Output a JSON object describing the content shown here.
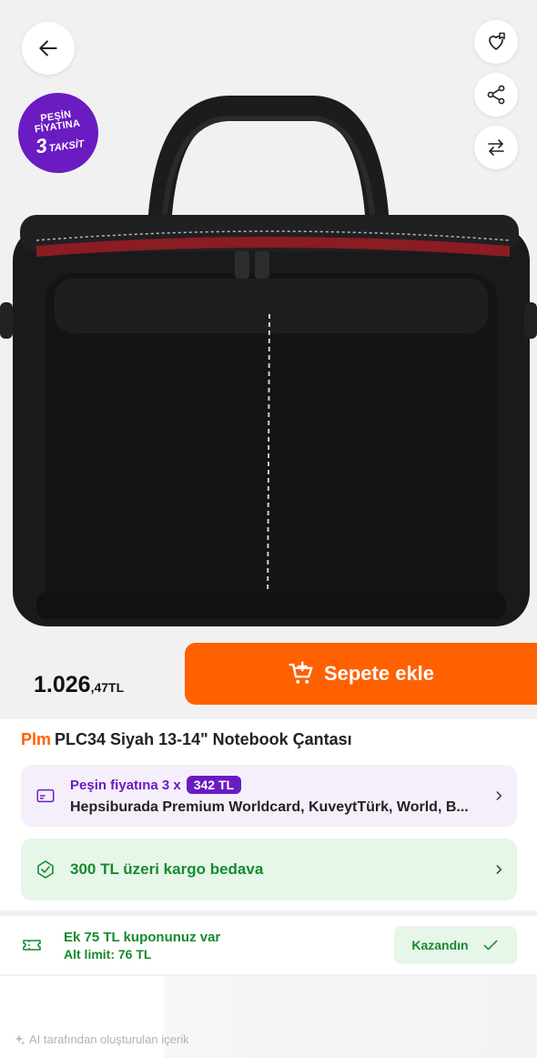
{
  "header": {
    "back_icon": "arrow-left-icon",
    "favorite_icon": "heart-list-icon",
    "share_icon": "share-icon",
    "compare_icon": "compare-arrows-icon"
  },
  "promo_badge": {
    "line1": "PEŞİN",
    "line2": "FİYATINA",
    "number": "3",
    "word": "TAKSİT",
    "color": "#6a1bc2"
  },
  "price": {
    "main": "1.026",
    "fraction": ",47",
    "currency": "TL"
  },
  "add_to_cart": {
    "label": "Sepete ekle",
    "icon": "cart-plus-icon",
    "color": "#ff6000"
  },
  "product": {
    "brand": "Plm",
    "title": "PLC34 Siyah 13-14\" Notebook Çantası"
  },
  "installment": {
    "prefix": "Peşin fiyatına 3 x",
    "amount": "342 TL",
    "cards": "Hepsiburada Premium Worldcard, KuveytTürk, World, B...",
    "icon": "credit-card-icon"
  },
  "cargo": {
    "text": "300 TL üzeri kargo bedava",
    "icon": "delivery-icon"
  },
  "coupon": {
    "line1": "Ek 75 TL kuponunuz var",
    "line2": "Alt limit: 76 TL",
    "button": "Kazandın",
    "icon": "ticket-icon",
    "check_icon": "check-icon"
  },
  "footer": {
    "ai_note": "AI tarafından oluşturulan içerik",
    "icon": "ai-sparkle-icon"
  }
}
